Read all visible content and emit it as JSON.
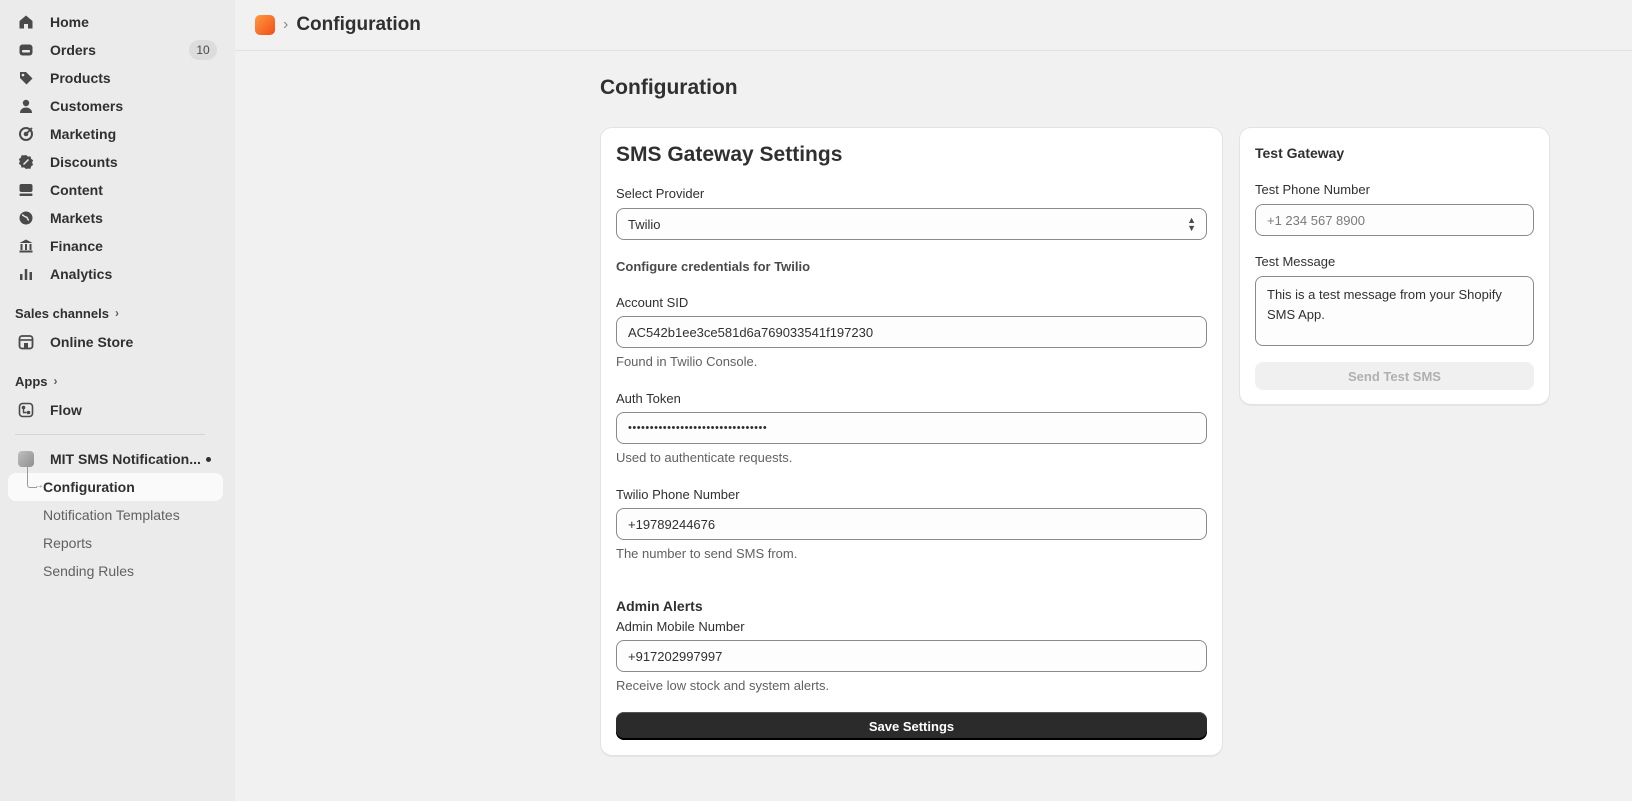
{
  "sidebar": {
    "nav": [
      {
        "label": "Home",
        "icon": "home-icon"
      },
      {
        "label": "Orders",
        "icon": "orders-icon",
        "badge": "10"
      },
      {
        "label": "Products",
        "icon": "tag-icon"
      },
      {
        "label": "Customers",
        "icon": "person-icon"
      },
      {
        "label": "Marketing",
        "icon": "target-icon"
      },
      {
        "label": "Discounts",
        "icon": "discount-icon"
      },
      {
        "label": "Content",
        "icon": "content-icon"
      },
      {
        "label": "Markets",
        "icon": "globe-icon"
      },
      {
        "label": "Finance",
        "icon": "bank-icon"
      },
      {
        "label": "Analytics",
        "icon": "bar-chart-icon"
      }
    ],
    "sales_channels_label": "Sales channels",
    "online_store_label": "Online Store",
    "apps_label": "Apps",
    "flow_label": "Flow",
    "app_name": "MIT SMS Notification...",
    "app_subitems": [
      "Configuration",
      "Notification Templates",
      "Reports",
      "Sending Rules"
    ]
  },
  "topbar": {
    "title": "Configuration"
  },
  "page": {
    "title": "Configuration"
  },
  "sms_settings": {
    "title": "SMS Gateway Settings",
    "provider_label": "Select Provider",
    "provider_value": "Twilio",
    "credentials_heading": "Configure credentials for Twilio",
    "account_sid_label": "Account SID",
    "account_sid_value": "AC542b1ee3ce581d6a769033541f197230",
    "account_sid_help": "Found in Twilio Console.",
    "auth_token_label": "Auth Token",
    "auth_token_value": "••••••••••••••••••••••••••••••••",
    "auth_token_help": "Used to authenticate requests.",
    "phone_label": "Twilio Phone Number",
    "phone_value": "+19789244676",
    "phone_help": "The number to send SMS from.",
    "admin_alerts_heading": "Admin Alerts",
    "admin_mobile_label": "Admin Mobile Number",
    "admin_mobile_value": "+917202997997",
    "admin_mobile_help": "Receive low stock and system alerts.",
    "save_button": "Save Settings"
  },
  "test_gateway": {
    "title": "Test Gateway",
    "phone_label": "Test Phone Number",
    "phone_placeholder": "+1 234 567 8900",
    "message_label": "Test Message",
    "message_value": "This is a test message from your Shopify SMS App.",
    "send_button": "Send Test SMS"
  },
  "colors": {
    "sidebar_bg": "#ebebeb",
    "page_bg": "#f1f1f1",
    "primary_button": "#2b2b2b",
    "app_badge": "#f26722"
  }
}
